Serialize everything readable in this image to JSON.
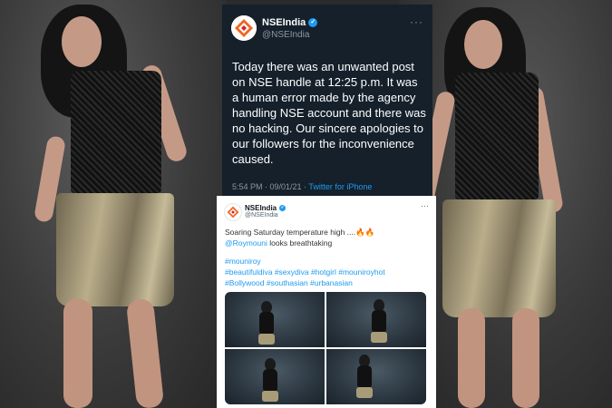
{
  "dark_tweet": {
    "account_name": "NSEIndia",
    "account_handle": "@NSEIndia",
    "verified_glyph": "✓",
    "more_glyph": "···",
    "body_text": "Today there was an unwanted post on NSE handle at 12:25 p.m. It was a human error made by the agency handling NSE account and there was no hacking. Our sincere apologies to our followers for the inconvenience caused.",
    "time": "5:54 PM · 09/01/21 ·",
    "source": "Twitter for iPhone"
  },
  "light_tweet": {
    "account_name": "NSEIndia",
    "account_handle": "@NSEIndia",
    "verified_glyph": "✓",
    "more_glyph": "···",
    "line1": "Soaring Saturday temperature high ....",
    "fire_emojis": "🔥🔥",
    "mention": "@Roymouni",
    "line2_rest": " looks breathtaking",
    "hashtag_lines": [
      "#mouniroy",
      "#beautifuldiva #sexydiva #hotgirl #mouniroyhot",
      "#Bollywood #southasian #urbanasian"
    ]
  },
  "colors": {
    "dark_bg": "#15202b",
    "link_blue": "#1d9bf0",
    "nse_orange": "#f26522",
    "nse_red": "#d71e28"
  },
  "icons": {
    "verified": "verified-badge-icon",
    "more": "more-options-icon",
    "logo": "nse-logo-icon"
  }
}
